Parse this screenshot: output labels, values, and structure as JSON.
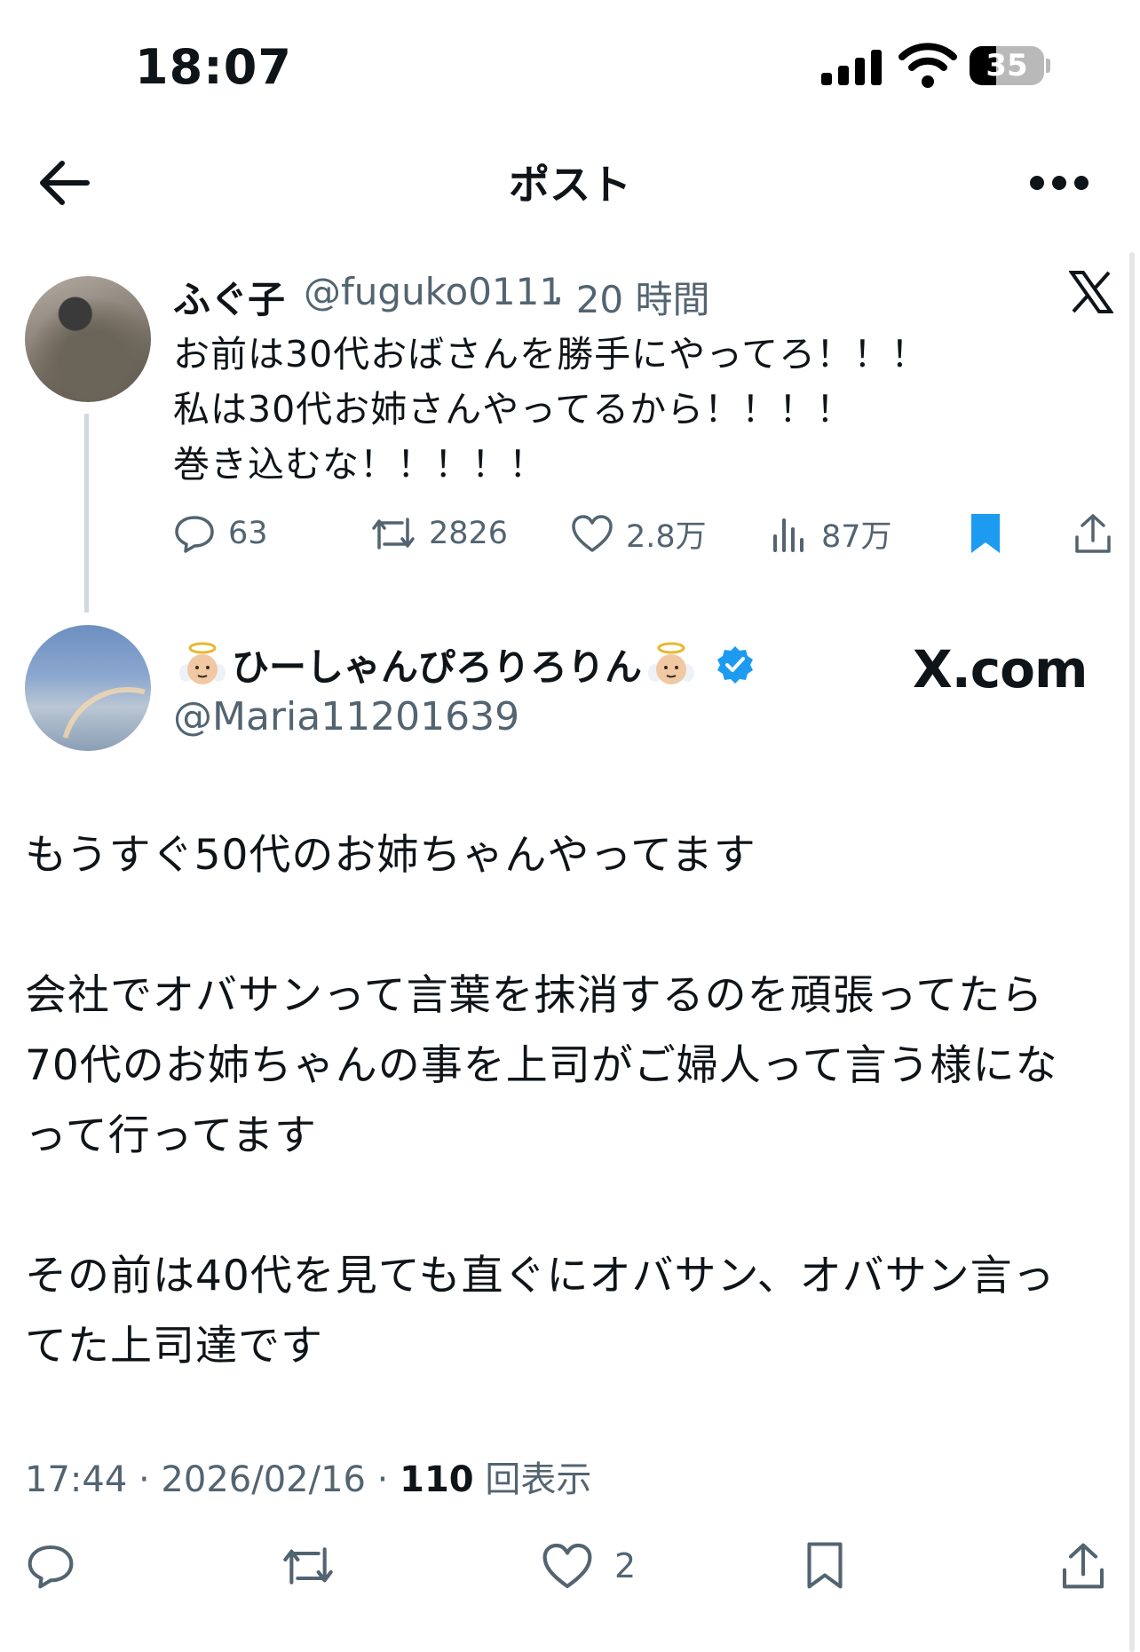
{
  "status_bar": {
    "time": "18:07",
    "battery": "35"
  },
  "header": {
    "title": "ポスト",
    "back_icon": "arrow-left-icon",
    "more_icon": "more-dots-icon"
  },
  "quoted_tweet": {
    "display_name": "ふぐ子",
    "handle": "@fuguko0111",
    "time": "· 20 時間",
    "text": "お前は30代おばさんを勝手にやってろ！！！\n私は30代お姉さんやってるから！！！！\n巻き込むな！！！！！",
    "replies": "63",
    "reposts": "2826",
    "likes": "2.8万",
    "views": "87万"
  },
  "main_tweet": {
    "display_name": "ひーしゃんぴろりろりん",
    "handle": "@Maria11201639",
    "watermark": "X.com",
    "text": "もうすぐ50代のお姉ちゃんやってます\n\n会社でオバサンって言葉を抹消するのを頑張ってたら\n70代のお姉ちゃんの事を上司がご婦人って言う様にな\nって行ってます\n\nその前は40代を見ても直ぐにオバサン、オバサン言っ\nてた上司達です",
    "meta_prefix": "17:44 · 2026/02/16 · ",
    "views_count": "110",
    "views_label": " 回表示",
    "likes": "2"
  },
  "colors": {
    "text": "#0f1419",
    "secondary": "#536471",
    "accent": "#1d9bf0",
    "thread": "#cfd9de"
  }
}
